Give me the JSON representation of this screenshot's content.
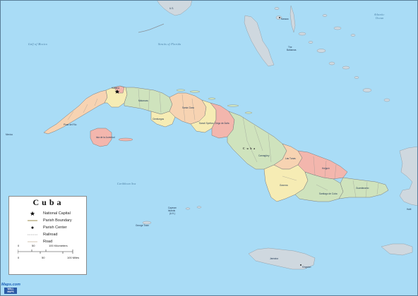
{
  "map": {
    "country_name": "C u b a",
    "colors": {
      "ocean": "#a9dcf6",
      "ocean_deep": "#9fd5f3",
      "foreign_land": "#cfd8df",
      "province_peach": "#f7d3b2",
      "province_yellow": "#f6ecb4",
      "province_green": "#cfe3bd",
      "province_pink": "#f3b6ad",
      "province_lilac": "#e6d0ea",
      "boundary": "#7a7a7a"
    },
    "labels": {
      "us": "U.S.",
      "nassau": "Nassau",
      "the_bahamas": "The\nBahamas",
      "bahamas_line1": "The",
      "bahamas_line2": "Bahamas",
      "atlantic_ocean": "Atlantic\nOcean",
      "atlantic_line1": "Atlantic",
      "atlantic_line2": "Ocean",
      "gulf_of_mexico": "Gulf of Mexico",
      "straits_of_florida": "Straits of Florida",
      "havana": "Havana",
      "cuba_center": "C u b a",
      "caribbean_sea": "Caribbean Sea",
      "cayman_islands": "Cayman\nIslands\n(U.K.)",
      "cayman_line1": "Cayman",
      "cayman_line2": "Islands",
      "cayman_line3": "(U.K.)",
      "george_town": "George Town",
      "jamaica": "Jamaica",
      "kingston": "Kingston",
      "haiti": "Haiti",
      "mexico": "Mexico",
      "santiago_de_cuba": "Santiago de Cuba",
      "guantanamo": "Guantánamo",
      "camaguey": "Camagüey",
      "holguin": "Holguín",
      "pinar_del_rio": "Pinar del Río",
      "isla_juventud": "Isla de la Juventud",
      "las_tunas": "Las Tunas",
      "granma": "Granma",
      "santa_clara": "Santa Clara",
      "matanzas": "Matanzas",
      "cienfuegos": "Cienfuegos",
      "ciego_de_avila": "Ciego de Ávila",
      "sancti_spiritus": "Sancti Spíritus"
    }
  },
  "legend": {
    "title": "Cuba",
    "items": [
      {
        "label": "National Capital",
        "symbol": "star-icon"
      },
      {
        "label": "Parish Boundary",
        "symbol": "parish-boundary-line-icon"
      },
      {
        "label": "Parish Center",
        "symbol": "dot-icon"
      },
      {
        "label": "Railroad",
        "symbol": "railroad-line-icon"
      },
      {
        "label": "Road",
        "symbol": "road-line-icon"
      }
    ],
    "scale": {
      "km_ticks": [
        "0",
        "50",
        "100 Kilometers"
      ],
      "mi_ticks": [
        "0",
        "50",
        "100 Miles"
      ]
    }
  },
  "brand": {
    "name": "Maps.com",
    "sub": "WALL MAPS"
  }
}
